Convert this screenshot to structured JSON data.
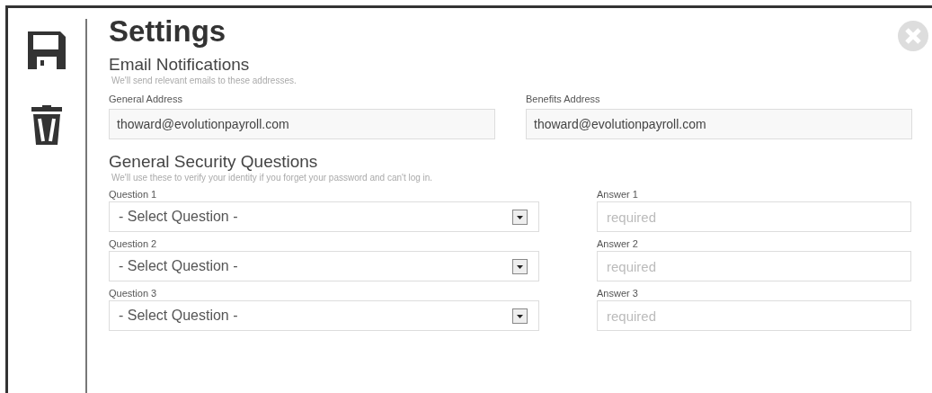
{
  "title": "Settings",
  "email": {
    "heading": "Email Notifications",
    "note": "We'll send relevant emails to these addresses.",
    "fields": [
      {
        "label": "General Address",
        "value": "thoward@evolutionpayroll.com"
      },
      {
        "label": "Benefits Address",
        "value": "thoward@evolutionpayroll.com"
      }
    ]
  },
  "security": {
    "heading": "General Security Questions",
    "note": "We'll use these to verify your identity if you forget your password and can't log in.",
    "rows": [
      {
        "question_label": "Question 1",
        "question_value": "- Select Question -",
        "answer_label": "Answer 1",
        "answer_placeholder": "required"
      },
      {
        "question_label": "Question 2",
        "question_value": "- Select Question -",
        "answer_label": "Answer 2",
        "answer_placeholder": "required"
      },
      {
        "question_label": "Question 3",
        "question_value": "- Select Question -",
        "answer_label": "Answer 3",
        "answer_placeholder": "required"
      }
    ]
  }
}
